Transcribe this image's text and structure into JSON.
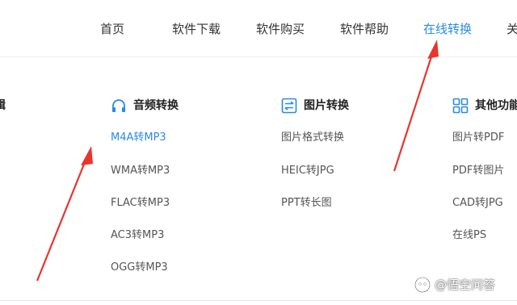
{
  "nav": {
    "items": [
      {
        "label": "首页"
      },
      {
        "label": "软件下载"
      },
      {
        "label": "软件购买"
      },
      {
        "label": "软件帮助"
      },
      {
        "label": "在线转换"
      },
      {
        "label": "关"
      }
    ],
    "active_color": "#2a8ae6"
  },
  "columns": {
    "left_partial_title": "辑",
    "audio": {
      "icon": "headphones-icon",
      "title": "音频转换",
      "links": [
        "M4A转MP3",
        "WMA转MP3",
        "FLAC转MP3",
        "AC3转MP3",
        "OGG转MP3"
      ]
    },
    "image": {
      "icon": "swap-arrows-icon",
      "title": "图片转换",
      "links": [
        "图片格式转换",
        "HEIC转JPG",
        "PPT转长图"
      ]
    },
    "other": {
      "icon": "grid-icon",
      "title": "其他功能",
      "links": [
        "图片转PDF",
        "PDF转图片",
        "CAD转JPG",
        "在线PS"
      ]
    }
  },
  "annotations": {
    "arrow_color": "#e8352e"
  },
  "watermark": {
    "text": "@悟空问答",
    "icon": "wukong-logo-icon"
  }
}
